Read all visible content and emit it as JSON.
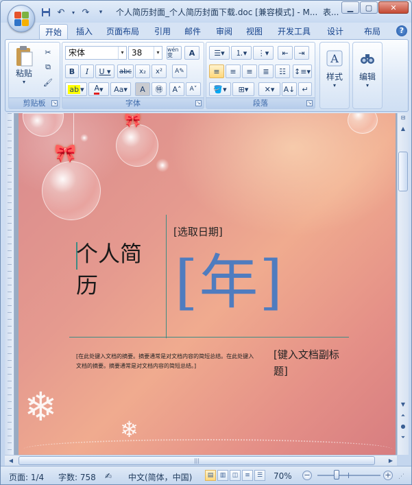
{
  "window": {
    "title": "个人简历封面_个人简历封面下载.doc [兼容模式] - M...",
    "title_suffix": "表...",
    "controls": [
      "minimize",
      "maximize",
      "close"
    ]
  },
  "quick_access": [
    "save-icon",
    "undo-icon",
    "redo-icon",
    "customize-icon"
  ],
  "tabs": [
    "开始",
    "插入",
    "页面布局",
    "引用",
    "邮件",
    "审阅",
    "视图",
    "开发工具",
    "设计",
    "布局"
  ],
  "active_tab": "开始",
  "ribbon": {
    "clipboard": {
      "label": "剪贴板",
      "paste_label": "粘贴"
    },
    "font": {
      "label": "字体",
      "font_name": "宋体",
      "font_size": "38",
      "wen_label": "wén 变",
      "a_label": "A"
    },
    "paragraph": {
      "label": "段落"
    },
    "styles": {
      "label": "样式"
    },
    "editing": {
      "label": "编辑"
    }
  },
  "document": {
    "title": "个人简历",
    "date_placeholder": "[选取日期]",
    "year_placeholder": "[年]",
    "abstract": "[在此处键入文档的摘要。摘要通常是对文档内容的简短总结。在此处键入文档的摘要。摘要通常是对文档内容的简短总结。]",
    "subtitle": "[键入文档副标题]"
  },
  "statusbar": {
    "page": "页面: 1/4",
    "word_count": "字数: 758",
    "language": "中文(简体，中国)",
    "zoom": "70%"
  },
  "colors": {
    "accent_line": "#3d8b83",
    "year_color": "#4f7cbf",
    "page_bg": "#e59a8f"
  }
}
